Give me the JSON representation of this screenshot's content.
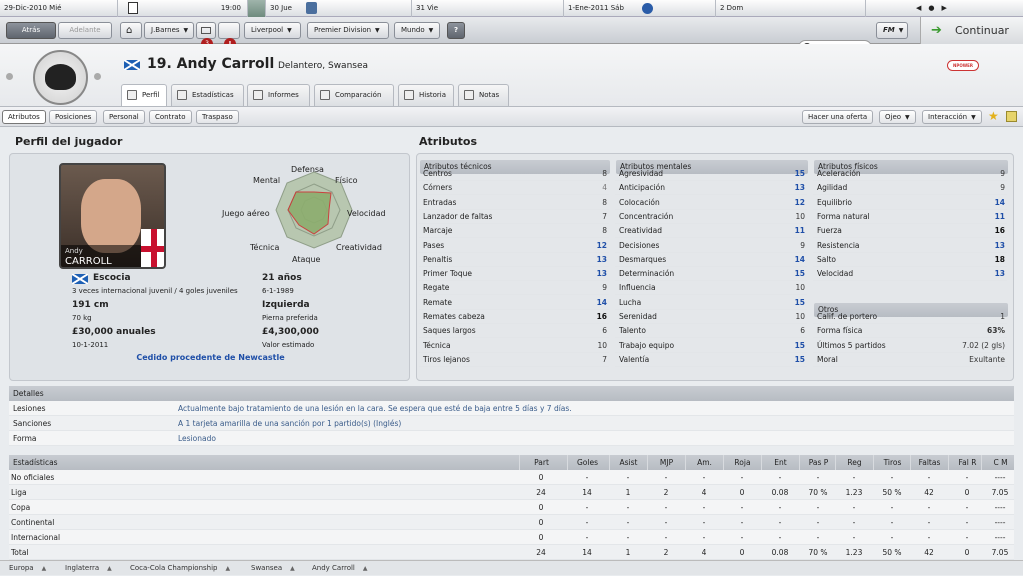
{
  "calendar": {
    "days": [
      {
        "label": "29-Dic-2010  Mié"
      },
      {
        "label": "19:00"
      },
      {
        "label": "30  Jue"
      },
      {
        "label": "31  Vie"
      },
      {
        "label": "1-Ene-2011  Sáb"
      },
      {
        "label": "2  Dom"
      }
    ]
  },
  "nav": {
    "back": "Atrás",
    "forward": "Adelante",
    "manager": "J.Barnes",
    "badge1": "3",
    "badge2": "!",
    "club": "Liverpool",
    "league": "Premier Division",
    "world": "Mundo",
    "help": "?",
    "fm": "FM",
    "continue": "Continuar"
  },
  "player": {
    "title": "19. Andy Carroll",
    "subtitle": "Delantero, Swansea",
    "firstname": "Andy",
    "lastname": "CARROLL",
    "nation": "Escocia",
    "caps": "3 veces internacional juvenil / 4 goles juveniles",
    "age": "21 años",
    "dob": "6-1-1989",
    "height": "191 cm",
    "weight": "70 kg",
    "foot": "Izquierda",
    "foot_label": "Pierna preferida",
    "wage": "£30,000 anuales",
    "contract": "10-1-2011",
    "value": "£4,300,000",
    "value_label": "Valor estimado",
    "loan": "Cedido procedente de Newcastle",
    "sponsor": "NPOWER"
  },
  "tabs": [
    "Perfil",
    "Estadísticas",
    "Informes",
    "Comparación",
    "Historia",
    "Notas"
  ],
  "subtabs": [
    "Atributos",
    "Posiciones",
    "Personal",
    "Contrato",
    "Traspaso"
  ],
  "actions": {
    "offer": "Hacer una oferta",
    "scout": "Ojeo",
    "interact": "Interacción"
  },
  "profile": {
    "heading": "Perfil del jugador",
    "radar": [
      "Defensa",
      "Físico",
      "Velocidad",
      "Creatividad",
      "Ataque",
      "Técnica",
      "Juego aéreo",
      "Mental"
    ]
  },
  "attributes": {
    "heading": "Atributos",
    "technical": {
      "title": "Atributos técnicos",
      "rows": [
        {
          "name": "Centros",
          "value": "8"
        },
        {
          "name": "Córners",
          "value": "4"
        },
        {
          "name": "Entradas",
          "value": "8"
        },
        {
          "name": "Lanzador de faltas",
          "value": "7"
        },
        {
          "name": "Marcaje",
          "value": "8"
        },
        {
          "name": "Pases",
          "value": "12"
        },
        {
          "name": "Penaltis",
          "value": "13"
        },
        {
          "name": "Primer Toque",
          "value": "13"
        },
        {
          "name": "Regate",
          "value": "9"
        },
        {
          "name": "Remate",
          "value": "14"
        },
        {
          "name": "Remates cabeza",
          "value": "16"
        },
        {
          "name": "Saques largos",
          "value": "6"
        },
        {
          "name": "Técnica",
          "value": "10"
        },
        {
          "name": "Tiros lejanos",
          "value": "7"
        }
      ]
    },
    "mental": {
      "title": "Atributos mentales",
      "rows": [
        {
          "name": "Agresividad",
          "value": "15"
        },
        {
          "name": "Anticipación",
          "value": "13"
        },
        {
          "name": "Colocación",
          "value": "12"
        },
        {
          "name": "Concentración",
          "value": "10"
        },
        {
          "name": "Creatividad",
          "value": "11"
        },
        {
          "name": "Decisiones",
          "value": "9"
        },
        {
          "name": "Desmarques",
          "value": "14"
        },
        {
          "name": "Determinación",
          "value": "15"
        },
        {
          "name": "Influencia",
          "value": "10"
        },
        {
          "name": "Lucha",
          "value": "15"
        },
        {
          "name": "Serenidad",
          "value": "10"
        },
        {
          "name": "Talento",
          "value": "6"
        },
        {
          "name": "Trabajo equipo",
          "value": "15"
        },
        {
          "name": "Valentía",
          "value": "15"
        }
      ]
    },
    "physical": {
      "title": "Atributos físicos",
      "rows": [
        {
          "name": "Aceleración",
          "value": "9"
        },
        {
          "name": "Agilidad",
          "value": "9"
        },
        {
          "name": "Equilibrio",
          "value": "14"
        },
        {
          "name": "Forma natural",
          "value": "11"
        },
        {
          "name": "Fuerza",
          "value": "16"
        },
        {
          "name": "Resistencia",
          "value": "13"
        },
        {
          "name": "Salto",
          "value": "18"
        },
        {
          "name": "Velocidad",
          "value": "13"
        }
      ]
    },
    "other": {
      "title": "Otros",
      "rows": [
        {
          "name": "Calif. de portero",
          "value": "1"
        },
        {
          "name": "Forma física",
          "value": "63%"
        },
        {
          "name": "Últimos 5 partidos",
          "value": "7.02 (2 gls)"
        },
        {
          "name": "Moral",
          "value": "Exultante"
        }
      ]
    }
  },
  "details": {
    "title": "Detalles",
    "rows": [
      {
        "label": "Lesiones",
        "value": "Actualmente bajo tratamiento de una lesión en la cara. Se espera que esté de baja entre 5 días y 7 días."
      },
      {
        "label": "Sanciones",
        "value": "A 1 tarjeta amarilla de una sanción por 1 partido(s) (Inglés)"
      },
      {
        "label": "Forma",
        "value": "Lesionado"
      }
    ]
  },
  "stats": {
    "title": "Estadísticas",
    "columns": [
      "Part",
      "Goles",
      "Asist",
      "MJP",
      "Am.",
      "Roja",
      "Ent",
      "Pas P",
      "Reg",
      "Tiros",
      "Faltas",
      "Fal R",
      "C M"
    ],
    "rows": [
      {
        "label": "No oficiales",
        "cells": [
          "0",
          "-",
          "-",
          "-",
          "-",
          "-",
          "-",
          "-",
          "-",
          "-",
          "-",
          "-",
          "----"
        ]
      },
      {
        "label": "Liga",
        "cells": [
          "24",
          "14",
          "1",
          "2",
          "4",
          "0",
          "0.08",
          "70 %",
          "1.23",
          "50 %",
          "42",
          "0",
          "7.05"
        ]
      },
      {
        "label": "Copa",
        "cells": [
          "0",
          "-",
          "-",
          "-",
          "-",
          "-",
          "-",
          "-",
          "-",
          "-",
          "-",
          "-",
          "----"
        ]
      },
      {
        "label": "Continental",
        "cells": [
          "0",
          "-",
          "-",
          "-",
          "-",
          "-",
          "-",
          "-",
          "-",
          "-",
          "-",
          "-",
          "----"
        ]
      },
      {
        "label": "Internacional",
        "cells": [
          "0",
          "-",
          "-",
          "-",
          "-",
          "-",
          "-",
          "-",
          "-",
          "-",
          "-",
          "-",
          "----"
        ]
      },
      {
        "label": "Total",
        "cells": [
          "24",
          "14",
          "1",
          "2",
          "4",
          "0",
          "0.08",
          "70 %",
          "1.23",
          "50 %",
          "42",
          "0",
          "7.05"
        ]
      }
    ]
  },
  "breadcrumbs": [
    "Europa",
    "Inglaterra",
    "Coca-Cola Championship",
    "Swansea",
    "Andy Carroll"
  ],
  "colors": {
    "accent_blue": "#1f4fa8",
    "badge_red": "#b01e1e",
    "continue_green": "#3a9a2e"
  }
}
